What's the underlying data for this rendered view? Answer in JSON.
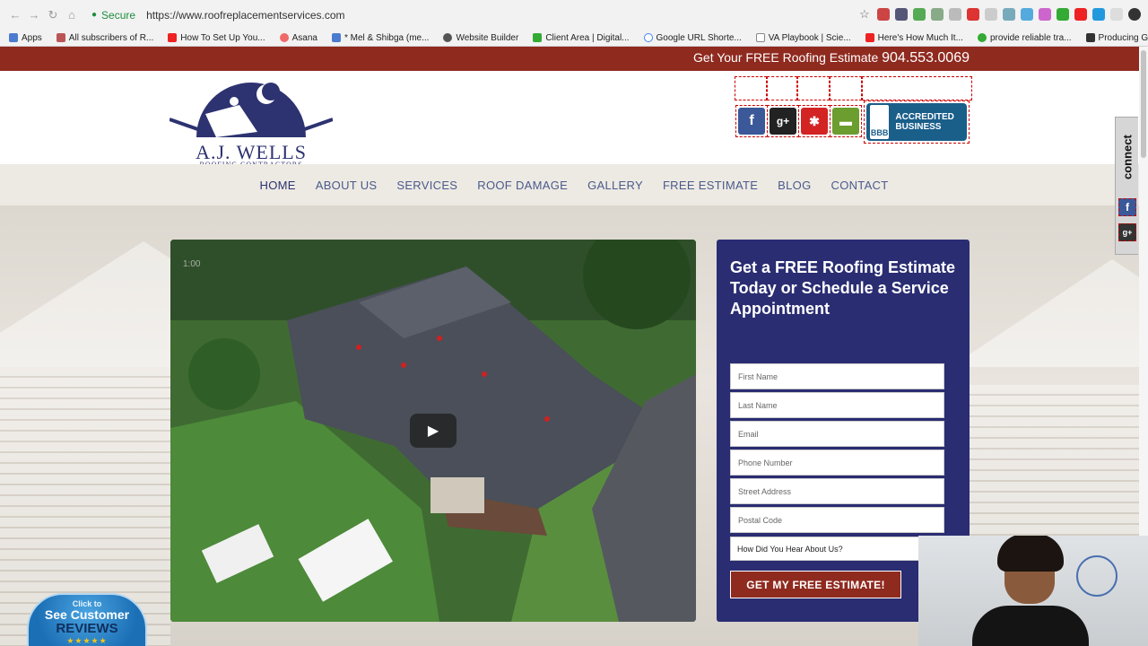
{
  "browser": {
    "secure_label": "Secure",
    "url": "https://www.roofreplacementservices.com",
    "bookmarks": [
      "Apps",
      "All subscribers of R...",
      "How To Set Up You...",
      "Asana",
      "* Mel & Shibga (me...",
      "Website Builder",
      "Client Area | Digital...",
      "Google URL Shorte...",
      "VA Playbook | Scie...",
      "Here's How Much It...",
      "provide reliable tra...",
      "Producing Good Co..."
    ]
  },
  "topbar": {
    "cta_text": "Get Your FREE Roofing Estimate",
    "phone": "904.553.0069"
  },
  "logo": {
    "name": "A.J. WELLS",
    "subtitle": "ROOFING CONTRACTORS"
  },
  "bbb": {
    "logo_text": "BBB",
    "badge_text": "ACCREDITED BUSINESS"
  },
  "nav": {
    "items": [
      "HOME",
      "ABOUT US",
      "SERVICES",
      "ROOF DAMAGE",
      "GALLERY",
      "FREE ESTIMATE",
      "BLOG",
      "CONTACT"
    ]
  },
  "video": {
    "time": "1:00"
  },
  "form": {
    "title": "Get a FREE Roofing Estimate Today or Schedule a Service Appointment",
    "fields": {
      "first_name": "First Name",
      "last_name": "Last Name",
      "email": "Email",
      "phone": "Phone Number",
      "street": "Street Address",
      "postal": "Postal Code"
    },
    "select_value": "How Did You Hear About Us?",
    "submit_label": "GET MY FREE ESTIMATE!"
  },
  "reviews": {
    "click": "Click to",
    "see": "See Customer",
    "big": "REVIEWS",
    "stars": "★★★★★"
  },
  "sidebar": {
    "label": "connect"
  },
  "colors": {
    "brand_red": "#8f2a1f",
    "brand_navy": "#2a2d72",
    "nav_bg": "#edeae3"
  }
}
